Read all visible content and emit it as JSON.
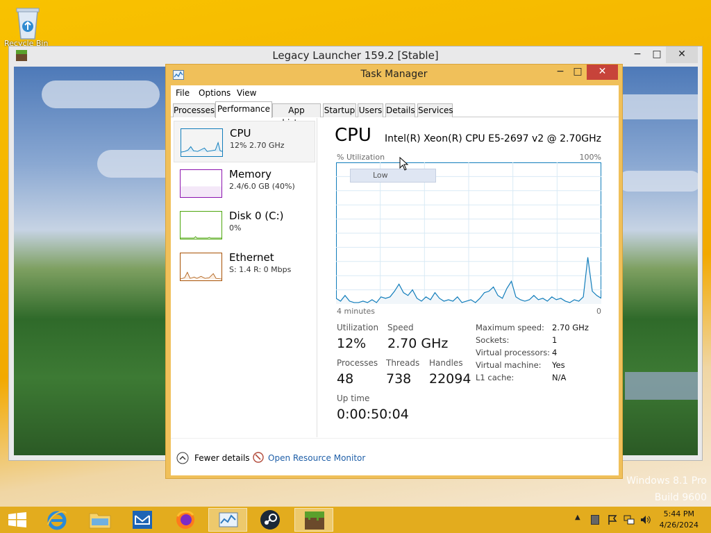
{
  "desktop": {
    "recycle_bin_label": "Recycle Bin",
    "watermark_line1": "Windows 8.1 Pro",
    "watermark_line2": "Build 9600"
  },
  "launcher": {
    "title": "Legacy Launcher 159.2 [Stable]",
    "minimize": "−",
    "maximize": "□",
    "close": "✕"
  },
  "task_manager": {
    "title": "Task Manager",
    "minimize": "−",
    "maximize": "□",
    "close": "✕",
    "menu": [
      "File",
      "Options",
      "View"
    ],
    "tabs": [
      "Processes",
      "Performance",
      "App history",
      "Startup",
      "Users",
      "Details",
      "Services"
    ],
    "active_tab": "Performance",
    "sidebar": [
      {
        "name": "CPU",
        "value": "12% 2.70 GHz",
        "color": "#117dbb"
      },
      {
        "name": "Memory",
        "value": "2.4/6.0 GB (40%)",
        "color": "#8b12ae"
      },
      {
        "name": "Disk 0 (C:)",
        "value": "0%",
        "color": "#4da60c"
      },
      {
        "name": "Ethernet",
        "value": "S: 1.4  R: 0 Mbps",
        "color": "#a74f01"
      }
    ],
    "cpu": {
      "title": "CPU",
      "model": "Intel(R) Xeon(R) CPU E5-2697 v2 @ 2.70GHz",
      "util_label": "% Utilization",
      "util_max": "100%",
      "axis_left": "4 minutes",
      "axis_right": "0",
      "tooltip": "Low",
      "stats": {
        "utilization_label": "Utilization",
        "utilization": "12%",
        "speed_label": "Speed",
        "speed": "2.70 GHz",
        "processes_label": "Processes",
        "processes": "48",
        "threads_label": "Threads",
        "threads": "738",
        "handles_label": "Handles",
        "handles": "22094",
        "uptime_label": "Up time",
        "uptime": "0:00:50:04"
      },
      "details": [
        {
          "k": "Maximum speed:",
          "v": "2.70 GHz"
        },
        {
          "k": "Sockets:",
          "v": "1"
        },
        {
          "k": "Virtual processors:",
          "v": "4"
        },
        {
          "k": "Virtual machine:",
          "v": "Yes"
        },
        {
          "k": "L1 cache:",
          "v": "N/A"
        }
      ],
      "history": [
        4,
        2,
        6,
        2,
        1,
        1,
        2,
        1,
        3,
        1,
        5,
        4,
        5,
        9,
        14,
        8,
        6,
        10,
        4,
        2,
        5,
        3,
        8,
        4,
        2,
        3,
        2,
        5,
        1,
        2,
        3,
        1,
        4,
        8,
        9,
        12,
        6,
        4,
        11,
        16,
        5,
        3,
        2,
        3,
        6,
        3,
        4,
        2,
        5,
        3,
        4,
        2,
        1,
        3,
        2,
        5,
        33,
        9,
        6,
        4
      ]
    },
    "footer": {
      "fewer_details": "Fewer details",
      "open_resource_monitor": "Open Resource Monitor"
    }
  },
  "taskbar": {
    "time": "5:44 PM",
    "date": "4/26/2024"
  }
}
